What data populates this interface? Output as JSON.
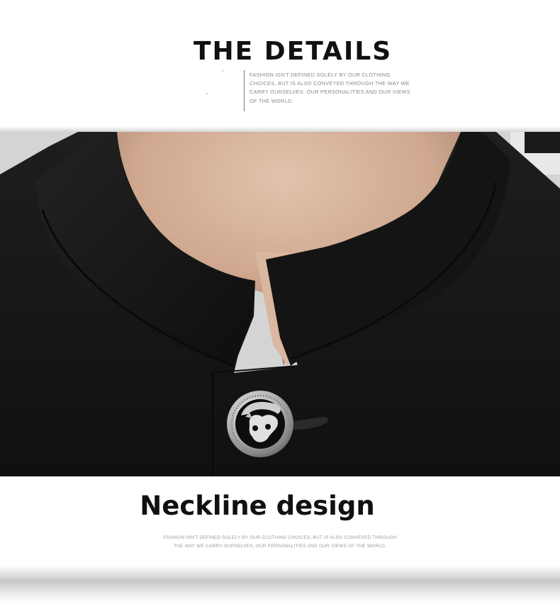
{
  "header": {
    "title": "THE DETAILS",
    "tagline": "FASHION ISN'T DEFINED SOLELY BY OUR CLOTHING CHOICES, BUT IS ALSO CONVEYED THROUGH THE WAY WE CARRY OURSELVES, OUR PERSONALITIES AND OUR VIEWS OF THE WORLD."
  },
  "detail": {
    "caption": "Neckline design",
    "subcaption": "FASHION ISN'T DEFINED SOLELY BY OUR CLOTHING CHOICES, BUT IS ALSO CONVEYED THROUGH THE WAY WE CARRY OURSELVES, OUR PERSONALITIES AND OUR VIEWS OF THE WORLD."
  },
  "colors": {
    "jacket": "#151515",
    "skin": "#d7b49c",
    "button_metal": "#c8c8c8",
    "button_enamel": "#0d0d0d"
  }
}
